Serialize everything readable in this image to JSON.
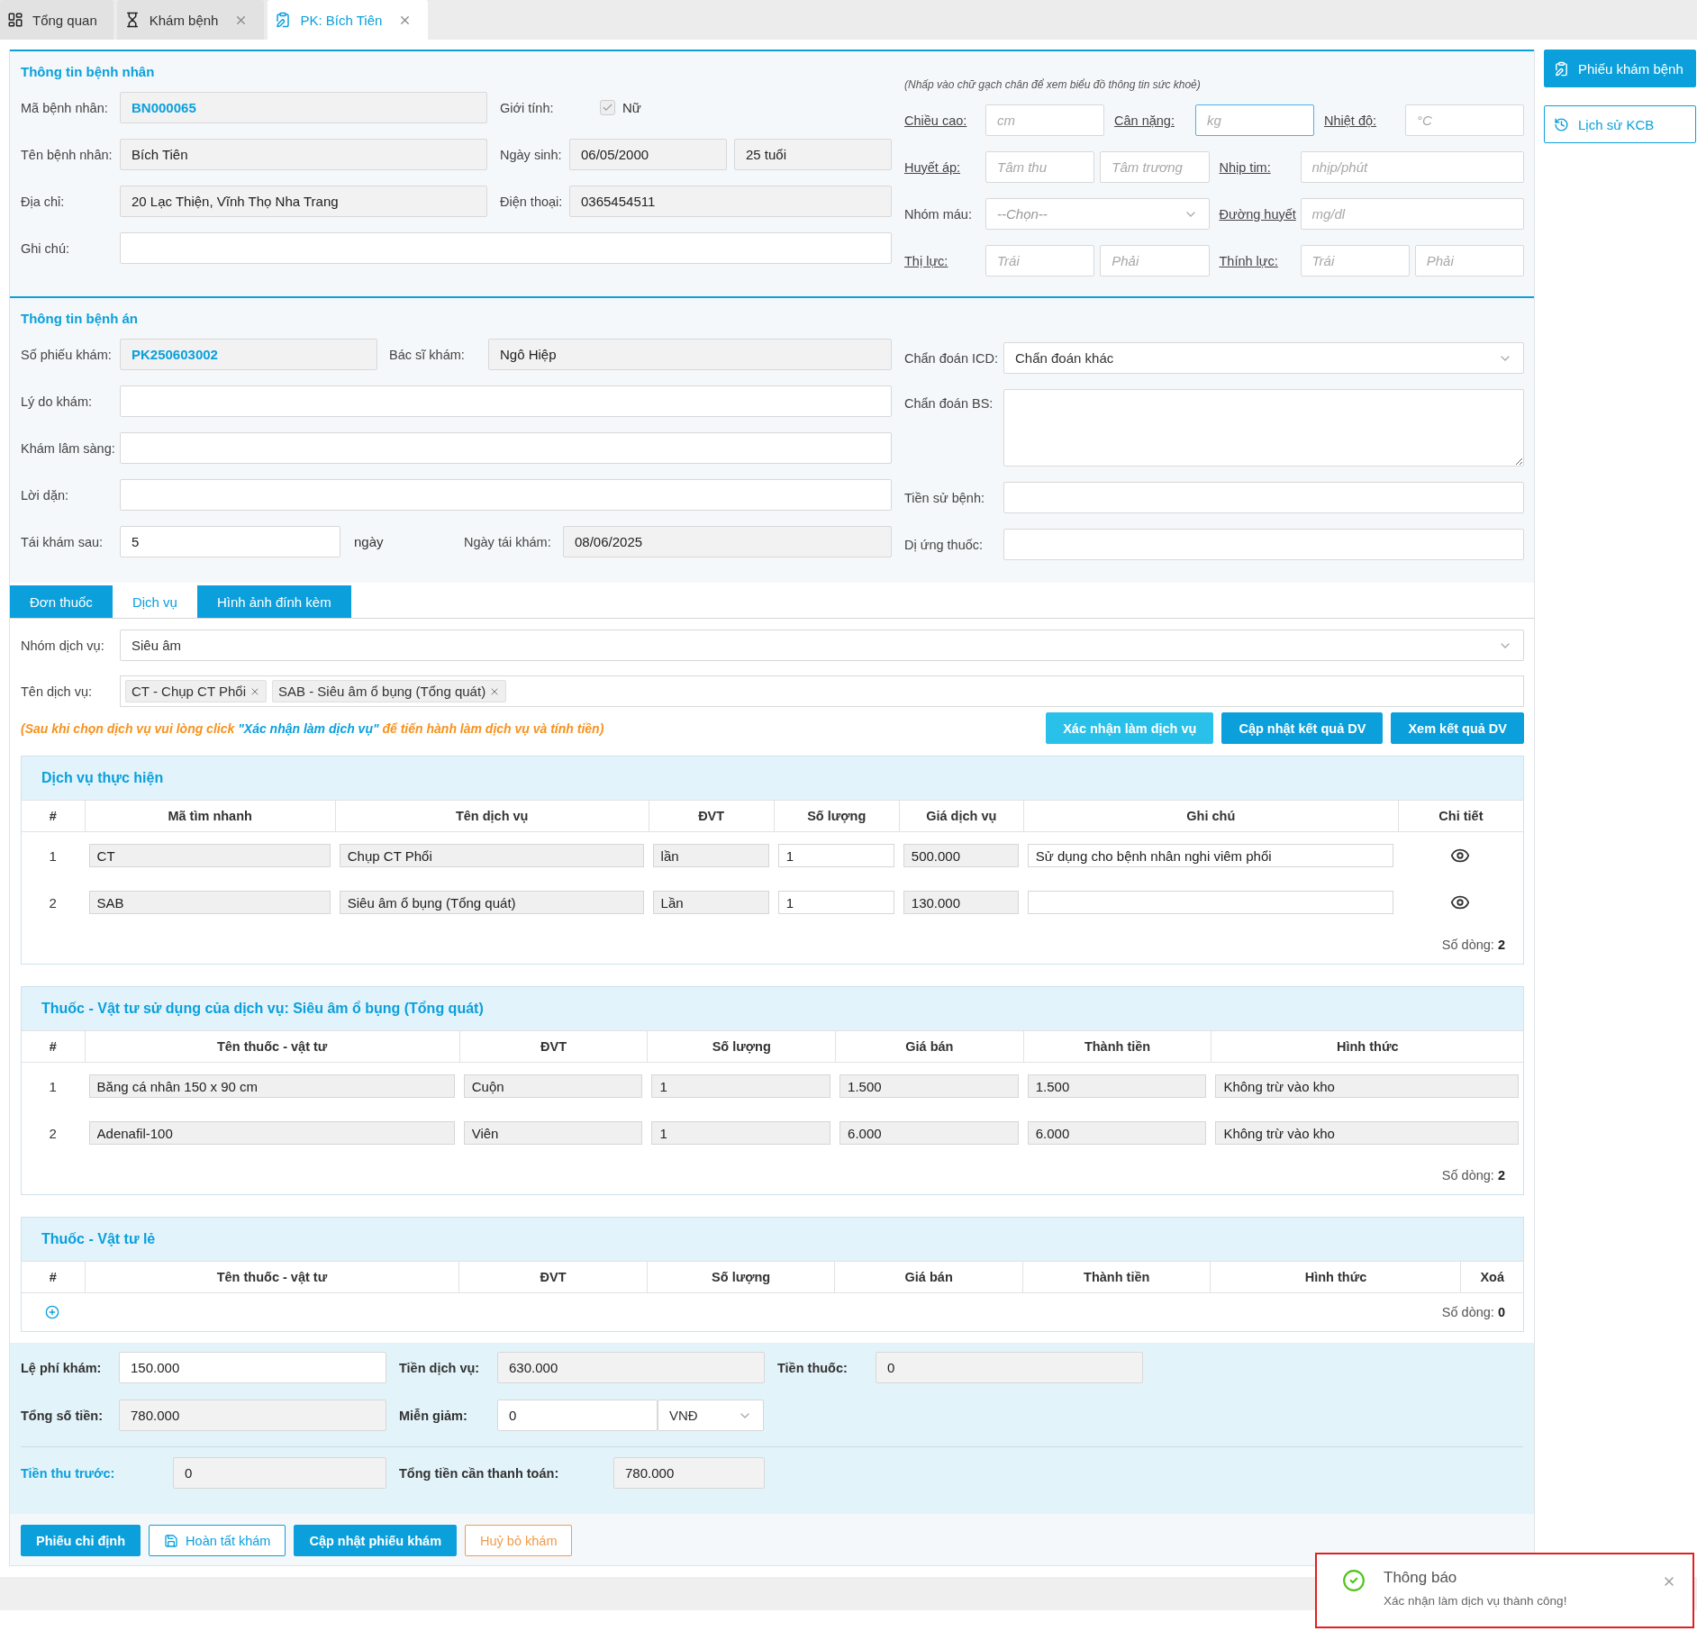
{
  "tabs": [
    {
      "label": "Tổng quan",
      "selected": false,
      "closable": false
    },
    {
      "label": "Khám bệnh",
      "selected": false,
      "closable": true
    },
    {
      "label": "PK: Bích Tiên",
      "selected": true,
      "closable": true
    }
  ],
  "patient": {
    "title": "Thông tin bệnh nhân",
    "code": {
      "label": "Mã bệnh nhân:",
      "value": "BN000065",
      "readonly": true,
      "highlight": true
    },
    "gender": {
      "label": "Giới tính:",
      "option": "Nữ",
      "checked": true
    },
    "name": {
      "label": "Tên bệnh nhân:",
      "value": "Bích Tiên",
      "readonly": true,
      "highlight": false
    },
    "birth_date": {
      "label": "Ngày sinh:",
      "value": "06/05/2000",
      "readonly": true,
      "highlight": false
    },
    "age": {
      "value": "25 tuổi",
      "readonly": true,
      "highlight": false
    },
    "address": {
      "label": "Địa chỉ:",
      "value": "20 Lạc Thiện, Vĩnh Thọ Nha Trang",
      "readonly": true,
      "highlight": false
    },
    "phone": {
      "label": "Điện thoại:",
      "value": "0365454511",
      "readonly": true,
      "highlight": false
    },
    "note": {
      "label": "Ghi chú:",
      "readonly": false
    }
  },
  "health": {
    "hint": "(Nhấp vào chữ gạch chân để xem biểu đồ thông tin sức khoẻ)",
    "rows": [
      [
        {
          "label": "Chiều cao:",
          "link": true,
          "inputs": [
            {
              "kind": "text",
              "placeholder": "cm",
              "focused": false
            }
          ]
        },
        {
          "label": "Cân nặng:",
          "link": true,
          "inputs": [
            {
              "kind": "text",
              "placeholder": "kg",
              "focused": true
            }
          ]
        },
        {
          "label": "Nhiệt độ:",
          "link": true,
          "inputs": [
            {
              "kind": "text",
              "placeholder": "°C",
              "focused": false
            }
          ]
        }
      ],
      [
        {
          "label": "Huyết áp:",
          "link": true,
          "inputs": [
            {
              "kind": "text",
              "placeholder": "Tâm thu",
              "focused": false
            },
            {
              "kind": "text",
              "placeholder": "Tâm trương",
              "focused": false
            }
          ]
        },
        {
          "label": "Nhịp tim:",
          "link": true,
          "inputs": [
            {
              "kind": "text",
              "placeholder": "nhịp/phút",
              "focused": false
            }
          ]
        }
      ],
      [
        {
          "label": "Nhóm máu:",
          "link": false,
          "inputs": [
            {
              "kind": "select",
              "placeholder": "--Chọn--",
              "focused": false
            }
          ]
        },
        {
          "label": "Đường huyết",
          "link": true,
          "inputs": [
            {
              "kind": "text",
              "placeholder": "mg/dl",
              "focused": false
            }
          ]
        }
      ],
      [
        {
          "label": "Thị lực:",
          "link": true,
          "inputs": [
            {
              "kind": "text",
              "placeholder": "Trái",
              "focused": false
            },
            {
              "kind": "text",
              "placeholder": "Phải",
              "focused": false
            }
          ]
        },
        {
          "label": "Thính lực:",
          "link": true,
          "inputs": [
            {
              "kind": "text",
              "placeholder": "Trái",
              "focused": false
            },
            {
              "kind": "text",
              "placeholder": "Phải",
              "focused": false
            }
          ]
        }
      ]
    ]
  },
  "medical": {
    "title": "Thông tin bệnh án",
    "ticket": {
      "label": "Số phiếu khám:",
      "value": "PK250603002",
      "readonly": true,
      "highlight": true
    },
    "doctor": {
      "label": "Bác sĩ khám:",
      "value": "Ngô Hiệp",
      "readonly": true,
      "highlight": false
    },
    "reason": {
      "label": "Lý do khám:",
      "readonly": false
    },
    "clinical": {
      "label": "Khám lâm sàng:",
      "readonly": false
    },
    "advice": {
      "label": "Lời dặn:",
      "readonly": false
    },
    "revisit_after": {
      "label": "Tái khám sau:",
      "value": "5",
      "unit": "ngày",
      "readonly": false,
      "highlight": false
    },
    "revisit_date": {
      "label": "Ngày tái khám:",
      "value": "08/06/2025",
      "readonly": true,
      "highlight": false
    },
    "icd": {
      "label": "Chẩn đoán ICD:",
      "value": "Chẩn đoán khác"
    },
    "diagnosis": {
      "label": "Chẩn đoán BS:"
    },
    "history": {
      "label": "Tiền sử bệnh:",
      "readonly": false
    },
    "allergy": {
      "label": "Dị ứng thuốc:",
      "readonly": false
    }
  },
  "detail_tabs": [
    {
      "label": "Đơn thuốc",
      "selected": false
    },
    {
      "label": "Dịch vụ",
      "selected": true
    },
    {
      "label": "Hình ảnh đính kèm",
      "selected": false
    }
  ],
  "services": {
    "group": {
      "label": "Nhóm dịch vụ:",
      "value": "Siêu âm"
    },
    "name": {
      "label": "Tên dịch vụ:",
      "tags": [
        "CT - Chụp CT Phổi",
        "SAB - Siêu âm ổ bụng (Tổng quát)"
      ]
    },
    "note": "(Sau khi chọn dịch vụ vui lòng click **\"Xác nhận làm dịch vụ\"** để tiến hành làm dịch vụ và tính tiền)",
    "buttons": [
      {
        "label": "Xác nhận làm dịch vụ",
        "kind": "light"
      },
      {
        "label": "Cập nhật kết quả DV",
        "kind": "primary"
      },
      {
        "label": "Xem kết quả DV",
        "kind": "primary"
      }
    ]
  },
  "tables": [
    {
      "title": "Dịch vụ thực hiện",
      "addable": false,
      "row_count": "Số dòng: **2**",
      "columns": [
        {
          "label": "#",
          "kind": "index"
        },
        {
          "label": "Mã tìm nhanh",
          "kind": "readonly"
        },
        {
          "label": "Tên dịch vụ",
          "kind": "readonly"
        },
        {
          "label": "ĐVT",
          "kind": "readonly"
        },
        {
          "label": "Số lượng",
          "kind": "input"
        },
        {
          "label": "Giá dịch vụ",
          "kind": "readonly"
        },
        {
          "label": "Ghi chú",
          "kind": "input"
        },
        {
          "label": "Chi tiết",
          "kind": "action"
        }
      ],
      "rows": [
        {
          "cells": [
            "1",
            "CT",
            "Chụp CT Phổi",
            "lần",
            "1",
            "500.000",
            "Sử dụng cho bệnh nhân nghi viêm phổi"
          ]
        },
        {
          "cells": [
            "2",
            "SAB",
            "Siêu âm ổ bụng (Tổng quát)",
            "Lần",
            "1",
            "130.000",
            null
          ]
        }
      ]
    },
    {
      "title": "Thuốc - Vật tư sử dụng của dịch vụ: Siêu âm ổ bụng (Tổng quát)",
      "addable": false,
      "row_count": "Số dòng: **2**",
      "columns": [
        {
          "label": "#",
          "kind": "index"
        },
        {
          "label": "Tên thuốc - vật tư",
          "kind": "readonly"
        },
        {
          "label": "ĐVT",
          "kind": "readonly"
        },
        {
          "label": "Số lượng",
          "kind": "readonly"
        },
        {
          "label": "Giá bán",
          "kind": "readonly"
        },
        {
          "label": "Thành tiền",
          "kind": "readonly"
        },
        {
          "label": "Hình thức",
          "kind": "readonly"
        }
      ],
      "rows": [
        {
          "cells": [
            "1",
            "Băng cá nhân 150 x 90 cm",
            "Cuộn",
            "1",
            "1.500",
            "1.500",
            "Không trừ vào kho"
          ]
        },
        {
          "cells": [
            "2",
            "Adenafil-100",
            "Viên",
            "1",
            "6.000",
            "6.000",
            "Không trừ vào kho"
          ]
        }
      ]
    },
    {
      "title": "Thuốc - Vật tư lẻ",
      "addable": true,
      "row_count": "Số dòng: **0**",
      "columns": [
        {
          "label": "#",
          "kind": "index"
        },
        {
          "label": "Tên thuốc - vật tư",
          "kind": "readonly"
        },
        {
          "label": "ĐVT",
          "kind": "readonly"
        },
        {
          "label": "Số lượng",
          "kind": "readonly"
        },
        {
          "label": "Giá bán",
          "kind": "readonly"
        },
        {
          "label": "Thành tiền",
          "kind": "readonly"
        },
        {
          "label": "Hình thức",
          "kind": "readonly"
        },
        {
          "label": "Xoá",
          "kind": "action"
        }
      ]
    }
  ],
  "summary": [
    [
      {
        "label": "Lệ phí khám:",
        "value": "150.000",
        "readonly": false,
        "accent": false
      },
      {
        "label": "Tiền dịch vụ:",
        "value": "630.000",
        "readonly": true,
        "accent": false
      },
      {
        "label": "Tiền thuốc:",
        "value": "0",
        "readonly": true,
        "accent": false
      }
    ],
    [
      {
        "label": "Tổng số tiền:",
        "value": "780.000",
        "readonly": true,
        "accent": false
      },
      {
        "label": "Miễn giảm:",
        "value": "0",
        "unit": "VNĐ",
        "readonly": false,
        "accent": false
      }
    ],
    [
      {
        "label": "Tiền thu trước:",
        "value": "0",
        "readonly": true,
        "accent": true
      },
      {
        "label": "Tổng tiền cần thanh toán:",
        "value": "780.000",
        "readonly": true,
        "accent": false
      }
    ]
  ],
  "actions": [
    {
      "label": "Phiếu chỉ định",
      "kind": "primary"
    },
    {
      "label": "Hoàn tất khám",
      "kind": "outline"
    },
    {
      "label": "Cập nhật phiếu khám",
      "kind": "primary"
    },
    {
      "label": "Huỷ bỏ khám",
      "kind": "danger"
    }
  ],
  "side": [
    {
      "label": "Phiếu khám bệnh",
      "selected": true
    },
    {
      "label": "Lịch sử KCB",
      "selected": false
    }
  ],
  "toast": {
    "title": "Thông báo",
    "message": "Xác nhận làm dịch vụ thành công!"
  }
}
